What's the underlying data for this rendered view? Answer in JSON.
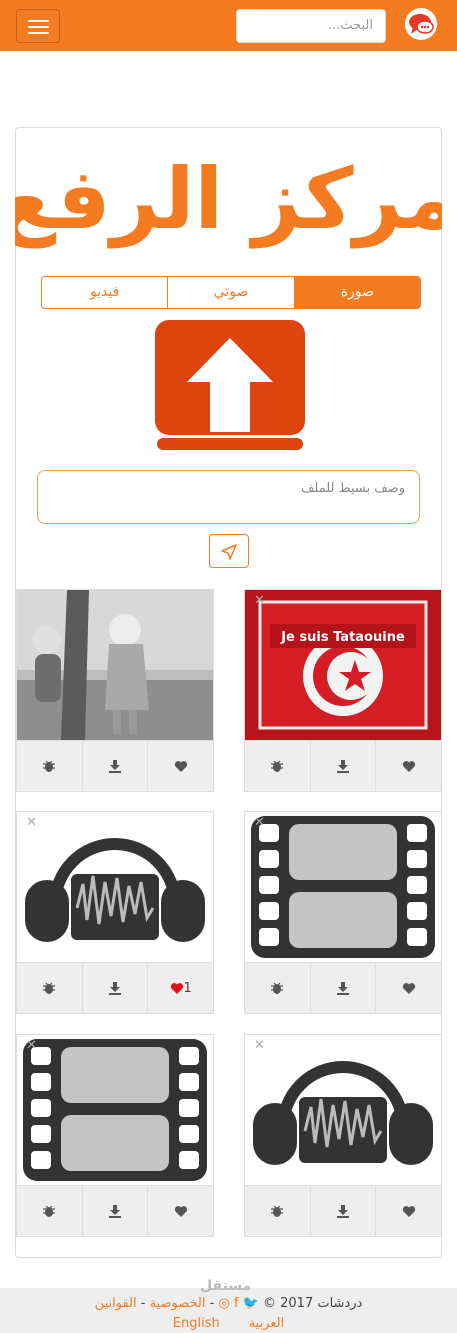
{
  "header": {
    "search_placeholder": "البحث...",
    "accent": "#f47b20"
  },
  "hero": {
    "title": "مركز الرفع"
  },
  "tabs": [
    {
      "label": "صورة",
      "active": true
    },
    {
      "label": "صوتي",
      "active": false
    },
    {
      "label": "فيديو",
      "active": false
    }
  ],
  "upload": {
    "description_placeholder": "وصف بسيط للملف"
  },
  "cards": [
    {
      "kind": "photo-kids",
      "likes": ""
    },
    {
      "kind": "tunisia-flag",
      "likes": "",
      "photo_text": "Je suis Tataouine"
    },
    {
      "kind": "audio",
      "likes": "1"
    },
    {
      "kind": "video",
      "likes": ""
    },
    {
      "kind": "video",
      "likes": ""
    },
    {
      "kind": "audio",
      "likes": ""
    }
  ],
  "footer": {
    "brand": "دردشات",
    "year": "2017 ©",
    "privacy": "الخصوصية",
    "rules": "القوانين",
    "sep": "-",
    "lang_ar": "العربية",
    "lang_en": "English",
    "watermark": "مستقل"
  }
}
